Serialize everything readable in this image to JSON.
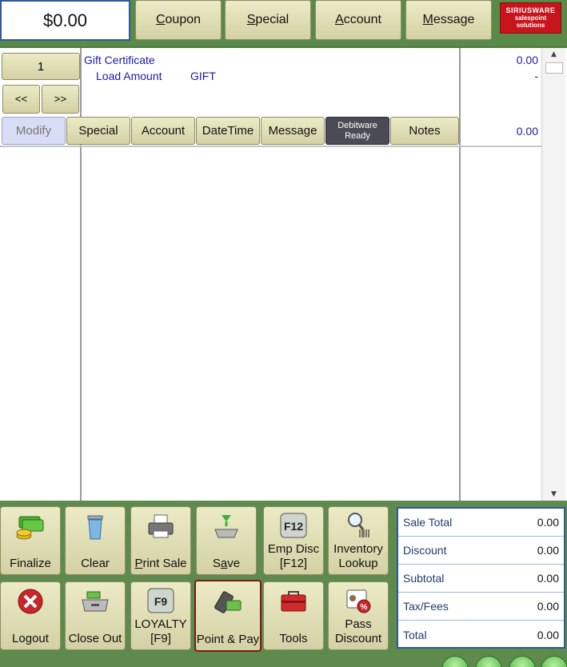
{
  "top": {
    "amount": "$0.00",
    "buttons": [
      {
        "key": "C",
        "rest": "oupon"
      },
      {
        "key": "S",
        "rest": "pecial"
      },
      {
        "key": "A",
        "rest": "ccount"
      },
      {
        "key": "M",
        "rest": "essage"
      }
    ],
    "logo": {
      "line1": "SIRIUSWARE",
      "line2": "salespoint",
      "line3": "solutions"
    }
  },
  "transaction": {
    "quantity": "1",
    "nav_prev": "<<",
    "nav_next": ">>",
    "item_name": "Gift Certificate",
    "item_sub": "Load Amount",
    "item_code": "GIFT",
    "item_price": "0.00",
    "item_dash": "-",
    "line_total": "0.00",
    "actions": {
      "modify": "Modify",
      "special": "Special",
      "account": "Account",
      "datetime": "DateTime",
      "message": "Message",
      "debitware_1": "Debitware",
      "debitware_2": "Ready",
      "notes": "Notes"
    }
  },
  "functions": {
    "finalize": "Finalize",
    "clear": "Clear",
    "print_sale_key": "P",
    "print_sale_rest": "rint Sale",
    "save_pre": "S",
    "save_key": "a",
    "save_rest": "ve",
    "emp_disc_1": "Emp Disc",
    "emp_disc_2": "[F12]",
    "emp_icon": "F12",
    "inventory_1": "Inventory",
    "inventory_2": "Lookup",
    "logout": "Logout",
    "close_out": "Close Out",
    "loyalty_1": "LOYALTY",
    "loyalty_2": "[F9]",
    "loyalty_icon": "F9",
    "point_pay": "Point & Pay",
    "tools": "Tools",
    "pass_disc_1": "Pass",
    "pass_disc_2": "Discount"
  },
  "totals": [
    {
      "label": "Sale Total",
      "value": "0.00"
    },
    {
      "label": "Discount",
      "value": "0.00"
    },
    {
      "label": "Subtotal",
      "value": "0.00"
    },
    {
      "label": "Tax/Fees",
      "value": "0.00"
    },
    {
      "label": "Total",
      "value": "0.00"
    }
  ],
  "colors": {
    "accent": "#2c5aa0",
    "button": "#e0dfb4",
    "background": "#5f8a4e",
    "item_text": "#1a1aa8"
  }
}
